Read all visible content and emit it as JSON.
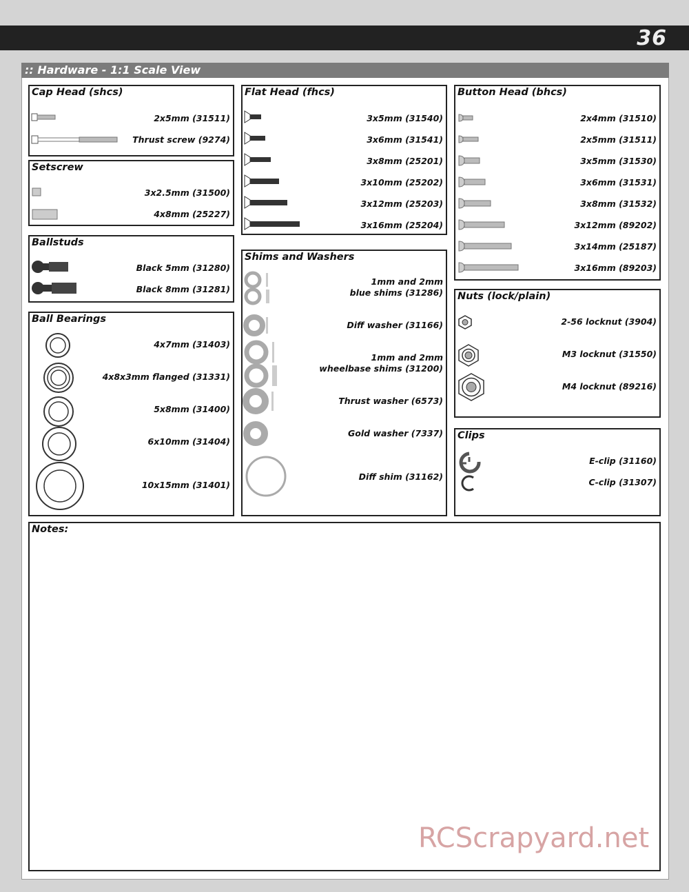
{
  "page": {
    "number": "36"
  },
  "header": {
    "title": ":: Hardware - 1:1 Scale View"
  },
  "sections": {
    "cap_head": {
      "title": "Cap Head (shcs)",
      "items": [
        {
          "label": "2x5mm (31511)"
        },
        {
          "label": "Thrust screw (9274)"
        }
      ]
    },
    "setscrew": {
      "title": "Setscrew",
      "items": [
        {
          "label": "3x2.5mm (31500)"
        },
        {
          "label": "4x8mm (25227)"
        }
      ]
    },
    "ballstuds": {
      "title": "Ballstuds",
      "items": [
        {
          "label": "Black 5mm (31280)"
        },
        {
          "label": "Black 8mm (31281)"
        }
      ]
    },
    "ball_bearings": {
      "title": "Ball Bearings",
      "items": [
        {
          "label": "4x7mm (31403)"
        },
        {
          "label": "4x8x3mm flanged (31331)"
        },
        {
          "label": "5x8mm (31400)"
        },
        {
          "label": "6x10mm (31404)"
        },
        {
          "label": "10x15mm (31401)"
        }
      ]
    },
    "flat_head": {
      "title": "Flat Head (fhcs)",
      "items": [
        {
          "label": "3x5mm (31540)"
        },
        {
          "label": "3x6mm (31541)"
        },
        {
          "label": "3x8mm (25201)"
        },
        {
          "label": "3x10mm (25202)"
        },
        {
          "label": "3x12mm (25203)"
        },
        {
          "label": "3x16mm (25204)"
        }
      ]
    },
    "shims": {
      "title": "Shims and Washers",
      "items": [
        {
          "line1": "1mm and 2mm",
          "line2": "blue shims (31286)"
        },
        {
          "line1": "Diff washer (31166)"
        },
        {
          "line1": "1mm and 2mm",
          "line2": "wheelbase shims (31200)"
        },
        {
          "line1": "Thrust washer (6573)"
        },
        {
          "line1": "Gold washer (7337)"
        },
        {
          "line1": "Diff shim (31162)"
        }
      ]
    },
    "button_head": {
      "title": "Button Head (bhcs)",
      "items": [
        {
          "label": "2x4mm (31510)"
        },
        {
          "label": "2x5mm (31511)"
        },
        {
          "label": "3x5mm (31530)"
        },
        {
          "label": "3x6mm (31531)"
        },
        {
          "label": "3x8mm (31532)"
        },
        {
          "label": "3x12mm (89202)"
        },
        {
          "label": "3x14mm (25187)"
        },
        {
          "label": "3x16mm  (89203)"
        }
      ]
    },
    "nuts": {
      "title": "Nuts (lock/plain)",
      "items": [
        {
          "label": "2-56 locknut (3904)"
        },
        {
          "label": "M3 locknut (31550)"
        },
        {
          "label": "M4 locknut (89216)"
        }
      ]
    },
    "clips": {
      "title": "Clips",
      "items": [
        {
          "label": "E-clip (31160)"
        },
        {
          "label": "C-clip (31307)"
        }
      ]
    },
    "notes": {
      "title": "Notes:"
    }
  },
  "watermark": "RCScrapyard.net"
}
